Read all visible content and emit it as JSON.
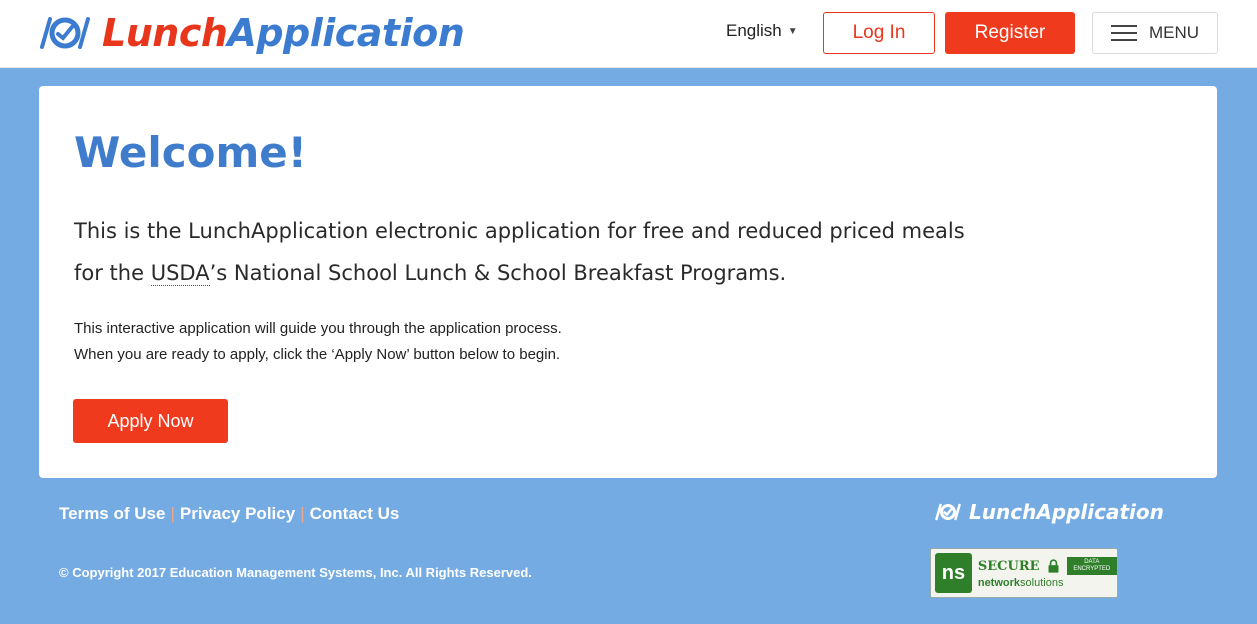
{
  "header": {
    "logo_lunch": "Lunch",
    "logo_application": "Application",
    "language": "English",
    "login_label": "Log In",
    "register_label": "Register",
    "menu_label": "MENU"
  },
  "main": {
    "title": "Welcome!",
    "lead_part1": "This is the LunchApplication electronic application for free and reduced priced meals for the ",
    "lead_usda": "USDA",
    "lead_part2": "’s National School Lunch & School Breakfast Programs.",
    "info_line1": "This interactive application will guide you through the application process.",
    "info_line2": "When you are ready to apply, click the ‘Apply Now’ button below to begin.",
    "apply_label": "Apply Now"
  },
  "footer": {
    "links": [
      "Terms of Use",
      "Privacy Policy",
      "Contact Us"
    ],
    "separator": "|",
    "copyright": "© Copyright 2017 Education Management Systems, Inc. All Rights Reserved.",
    "logo_text": "LunchApplication",
    "seal": {
      "mark": "ns",
      "secure": "SECURE",
      "encrypted": "DATA ENCRYPTED",
      "vendor_bold": "network",
      "vendor_rest": "solutions"
    }
  },
  "colors": {
    "brand_red": "#ef3a1d",
    "brand_blue": "#3b7bd0",
    "background_blue": "#75abe3"
  },
  "icons": {
    "logo": "lunchapplication-logo-icon",
    "language_caret": "caret-down-icon",
    "menu": "hamburger-icon",
    "lock": "lock-icon"
  }
}
